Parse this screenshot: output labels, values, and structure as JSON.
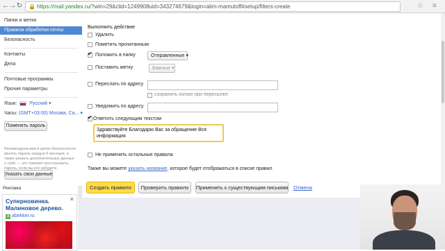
{
  "browser": {
    "back_glyph": "←",
    "forward_glyph": "→",
    "reload_glyph": "↻",
    "lock_glyph": "🔒",
    "url_host": "https://mail.yandex.ru",
    "url_path": "/?win=29&clid=1249908uid=343274679&login=alim-mamutoff#setup/filters-create",
    "star_glyph": "☆",
    "menu_glyph": "≡"
  },
  "sidebar": {
    "items": [
      "Папки и метки",
      "Правила обработки почты",
      "Безопасность",
      "Контакты",
      "Дела",
      "Почтовые программы",
      "Прочие параметры"
    ],
    "language_label": "Язык:",
    "language_value": "Русский",
    "time_label": "Часы:",
    "time_value": "(GMT+03:00) Москва, Са...",
    "change_password_button": "Поменять пароль",
    "password_note": "Рекомендуем вам в целях безопасности менять пароль каждые 6 месяцев, а также указать дополнительные данные о себе — это поможет восстановить пароль, если вы его забудете.",
    "your_data_button": "Указать свои данные"
  },
  "ad": {
    "label": "Реклама",
    "title": "Суперновинка. Малиновое дерево.",
    "site": "abekker.ru",
    "close_glyph": "✕"
  },
  "form": {
    "section_title": "Выполнить действие",
    "delete_label": "Удалить",
    "mark_read_label": "Пометить прочитанным",
    "move_to_folder_label": "Положить в папку",
    "folder_select": "Отправленные",
    "set_label_label": "Поставить метку",
    "label_select": "Важные",
    "forward_label": "Переслать по адресу",
    "save_copy_label": "сохранить копию при пересылке",
    "notify_label": "Уведомить по адресу",
    "reply_label": "Ответить следующим текстом",
    "reply_text": "Здравствуйте Благодарю Вас за обращение  Вся информация",
    "no_other_rules_label": "Не применять остальные правила",
    "name_hint_prefix": "Также вы можете",
    "name_hint_link": "указать название",
    "name_hint_suffix": ", которое будет отображаться в списке правил",
    "create_button": "Создать правило",
    "check_button": "Проверить правило",
    "apply_existing_button": "Применить к существующим письмам",
    "cancel_link": "Отмена"
  },
  "checkboxes": {
    "delete": false,
    "mark_read": false,
    "move_to_folder": true,
    "set_label": false,
    "forward": false,
    "save_copy": false,
    "notify": false,
    "reply": true,
    "no_other_rules": false
  }
}
